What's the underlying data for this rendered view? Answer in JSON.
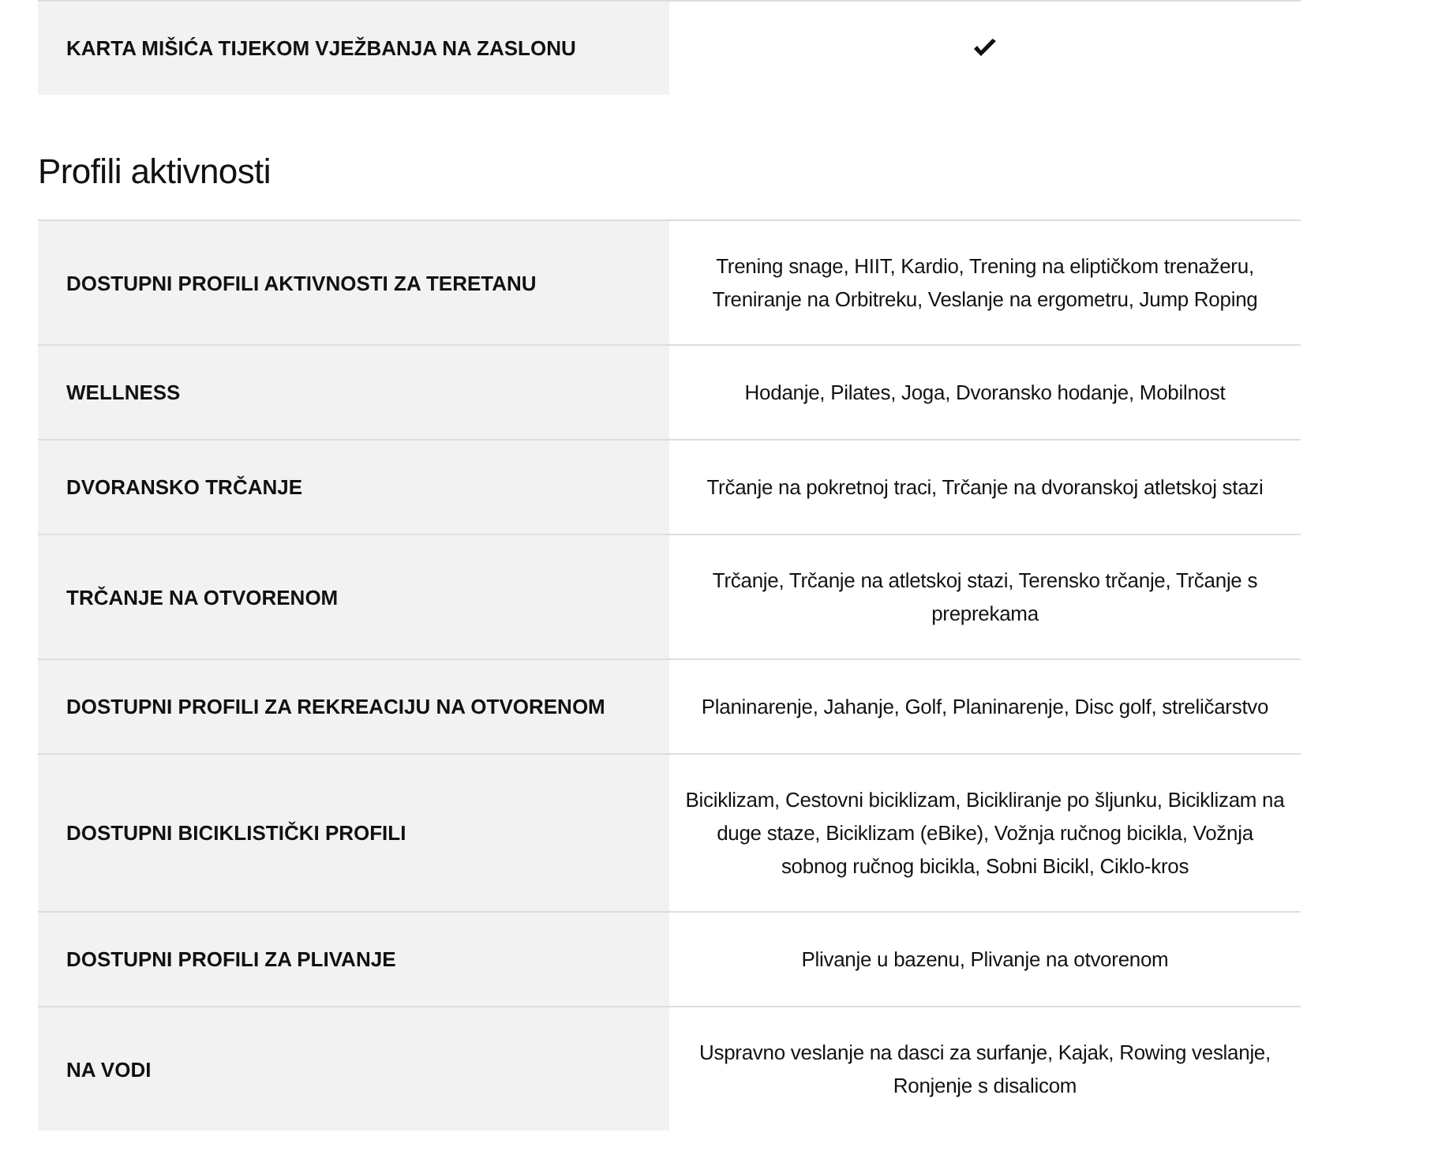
{
  "sections": [
    {
      "rows": [
        {
          "kind": "check",
          "label": "KARTA MIŠIĆA TIJEKOM VJEŽBANJA NA ZASLONU",
          "checked": true
        }
      ]
    },
    {
      "title": "Profili aktivnosti",
      "rows": [
        {
          "kind": "text",
          "label": "DOSTUPNI PROFILI AKTIVNOSTI ZA TERETANU",
          "value": "Trening snage, HIIT, Kardio, Trening na eliptičkom trenažeru, Treniranje na Orbitreku, Veslanje na ergometru, Jump Roping"
        },
        {
          "kind": "text",
          "label": "WELLNESS",
          "value": "Hodanje, Pilates, Joga, Dvoransko hodanje, Mobilnost"
        },
        {
          "kind": "text",
          "label": "DVORANSKO TRČANJE",
          "value": "Trčanje na pokretnoj traci, Trčanje na dvoranskoj atletskoj stazi"
        },
        {
          "kind": "text",
          "label": "TRČANJE NA OTVORENOM",
          "value": "Trčanje, Trčanje na atletskoj stazi, Terensko trčanje, Trčanje s preprekama"
        },
        {
          "kind": "text",
          "label": "DOSTUPNI PROFILI ZA REKREACIJU NA OTVORENOM",
          "value": "Planinarenje, Jahanje, Golf, Planinarenje, Disc golf, streličarstvo"
        },
        {
          "kind": "text",
          "label": "DOSTUPNI BICIKLISTIČKI PROFILI",
          "value": "Biciklizam, Cestovni biciklizam, Bicikliranje po šljunku, Biciklizam na duge staze, Biciklizam (eBike), Vožnja ručnog bicikla, Vožnja sobnog ručnog bicikla, Sobni Bicikl, Ciklo-kros"
        },
        {
          "kind": "text",
          "label": "DOSTUPNI PROFILI ZA PLIVANJE",
          "value": "Plivanje u bazenu, Plivanje na otvorenom"
        },
        {
          "kind": "text",
          "label": "NA VODI",
          "value": "Uspravno veslanje na dasci za surfanje, Kajak, Rowing veslanje, Ronjenje s disalicom"
        }
      ]
    }
  ]
}
